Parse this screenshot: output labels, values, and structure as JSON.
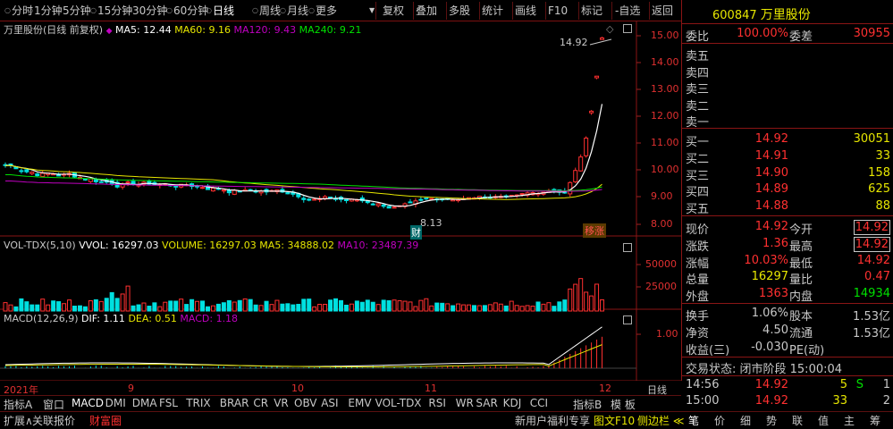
{
  "toolbar": {
    "periods": [
      "分时",
      "1分钟",
      "5分钟",
      "15分钟",
      "30分钟",
      "60分钟",
      "日线",
      "周线",
      "月线",
      "更多"
    ],
    "selected_period": "日线",
    "tools": [
      "复权",
      "叠加",
      "多股",
      "统计",
      "画线",
      "F10",
      "标记",
      "-自选",
      "返回"
    ]
  },
  "stock": {
    "code": "600847",
    "name": "万里股份"
  },
  "main_legend": {
    "title": "万里股份(日线 前复权)",
    "ma5": "MA5: 12.44",
    "ma60": "MA60: 9.16",
    "ma120": "MA120: 9.43",
    "ma240": "MA240: 9.21"
  },
  "price_axis": [
    "15.00",
    "14.00",
    "13.00",
    "12.00",
    "11.00",
    "10.00",
    "9.00",
    "8.00"
  ],
  "high_label": "14.92",
  "low_label": "8.13",
  "fin_tag": "财",
  "zt_tag": "移涨",
  "vol_legend": {
    "title": "VOL-TDX(5,10)",
    "vvol": "VVOL: 16297.03",
    "volume": "VOLUME: 16297.03",
    "ma5": "MA5: 34888.02",
    "ma10": "MA10: 23487.39"
  },
  "vol_axis": [
    "50000",
    "25000"
  ],
  "macd_legend": {
    "title": "MACD(12,26,9)",
    "dif": "DIF: 1.11",
    "dea": "DEA: 0.51",
    "macd": "MACD: 1.18"
  },
  "macd_axis": [
    "1.00"
  ],
  "x_axis": [
    "2021年",
    "9",
    "10",
    "11",
    "12"
  ],
  "x_right": "日线",
  "indicator_tabs": [
    "指标A",
    "窗口",
    "MACD",
    "DMI",
    "DMA",
    "FSL",
    "TRIX",
    "BRAR",
    "CR",
    "VR",
    "OBV",
    "ASI",
    "EMV",
    "VOL-TDX",
    "RSI",
    "WR",
    "SAR",
    "KDJ",
    "CCI"
  ],
  "indicator_right": [
    "指标B",
    "模 板"
  ],
  "bottom_tabs": [
    "扩展∧",
    "关联报价",
    "财富圈"
  ],
  "bottom_promo": "新用户福利专享",
  "bottom_right": [
    "图文F10",
    "侧边栏 ≪"
  ],
  "quote": {
    "weibi_label": "委比",
    "weibi": "100.00%",
    "weicha_label": "委差",
    "weicha": "30955",
    "sell": [
      {
        "l": "卖五"
      },
      {
        "l": "卖四"
      },
      {
        "l": "卖三"
      },
      {
        "l": "卖二"
      },
      {
        "l": "卖一"
      }
    ],
    "buy": [
      {
        "l": "买一",
        "p": "14.92",
        "v": "30051"
      },
      {
        "l": "买二",
        "p": "14.91",
        "v": "33"
      },
      {
        "l": "买三",
        "p": "14.90",
        "v": "158"
      },
      {
        "l": "买四",
        "p": "14.89",
        "v": "625"
      },
      {
        "l": "买五",
        "p": "14.88",
        "v": "88"
      }
    ],
    "stats": [
      {
        "l1": "现价",
        "v1": "14.92",
        "l2": "今开",
        "v2": "14.92"
      },
      {
        "l1": "涨跌",
        "v1": "1.36",
        "l2": "最高",
        "v2": "14.92"
      },
      {
        "l1": "涨幅",
        "v1": "10.03%",
        "l2": "最低",
        "v2": "14.92"
      },
      {
        "l1": "总量",
        "v1": "16297",
        "l2": "量比",
        "v2": "0.47"
      },
      {
        "l1": "外盘",
        "v1": "1363",
        "l2": "内盘",
        "v2": "14934"
      }
    ],
    "stats2": [
      {
        "l1": "换手",
        "v1": "1.06%",
        "l2": "股本",
        "v2": "1.53亿"
      },
      {
        "l1": "净资",
        "v1": "4.50",
        "l2": "流通",
        "v2": "1.53亿"
      },
      {
        "l1": "收益(三)",
        "v1": "-0.030",
        "l2": "PE(动)",
        "v2": ""
      }
    ],
    "status": "交易状态: 闭市阶段 15:00:04",
    "ticks": [
      {
        "t": "14:56",
        "p": "14.92",
        "v": "5",
        "d": "S",
        "n": "1"
      },
      {
        "t": "15:00",
        "p": "14.92",
        "v": "33",
        "d": "",
        "n": "2"
      }
    ]
  },
  "right_tabs": [
    "笔",
    "价",
    "细",
    "势",
    "联",
    "值",
    "主",
    "筹"
  ],
  "colors": {
    "up": "#ff3030",
    "down": "#00e0e0",
    "ma5": "#ffffff",
    "ma60": "#e6e600",
    "ma120": "#00e000",
    "ma240": "#c000c0",
    "border": "#8a1515"
  }
}
